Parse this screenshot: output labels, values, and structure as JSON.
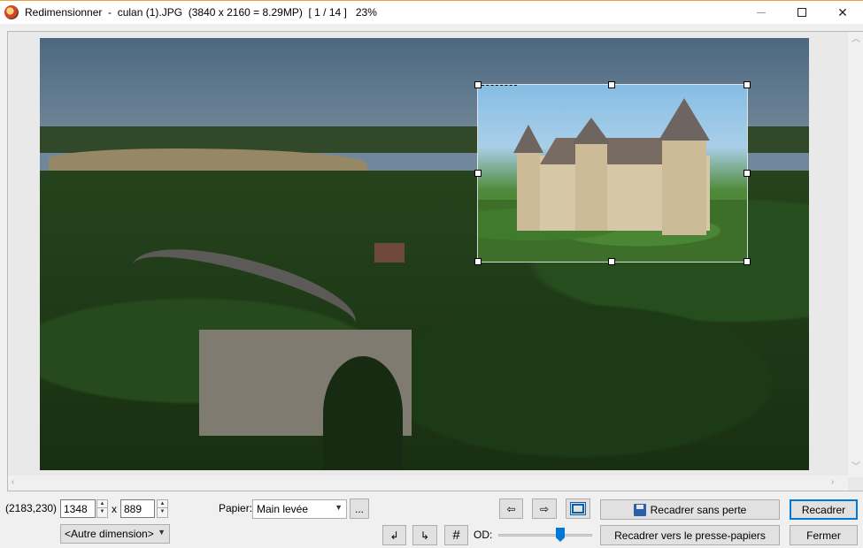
{
  "window": {
    "title": "Redimensionner  -  culan (1).JPG  (3840 x 2160 = 8.29MP)  [ 1 / 14 ]   23%",
    "minimize_label": "",
    "maximize_label": "",
    "close_label": "✕"
  },
  "status": {
    "coords": "(2183,230)"
  },
  "size": {
    "width": "1348",
    "height": "889",
    "separator": "x",
    "preset": "<Autre dimension>"
  },
  "paper": {
    "label": "Papier:",
    "value": "Main levée",
    "more_label": "..."
  },
  "buttons": {
    "prev": "⇦",
    "next": "⇨",
    "fit": "",
    "rotate_left": "↲",
    "rotate_right": "↳",
    "grid": "#",
    "crop_lossless": "Recadrer sans perte",
    "crop_clipboard": "Recadrer vers le presse-papiers",
    "crop": "Recadrer",
    "close": "Fermer"
  },
  "od": {
    "label": "OD:",
    "level": 0.65
  },
  "colors": {
    "accent": "#0078d7",
    "title_border": "#e8a33a"
  }
}
